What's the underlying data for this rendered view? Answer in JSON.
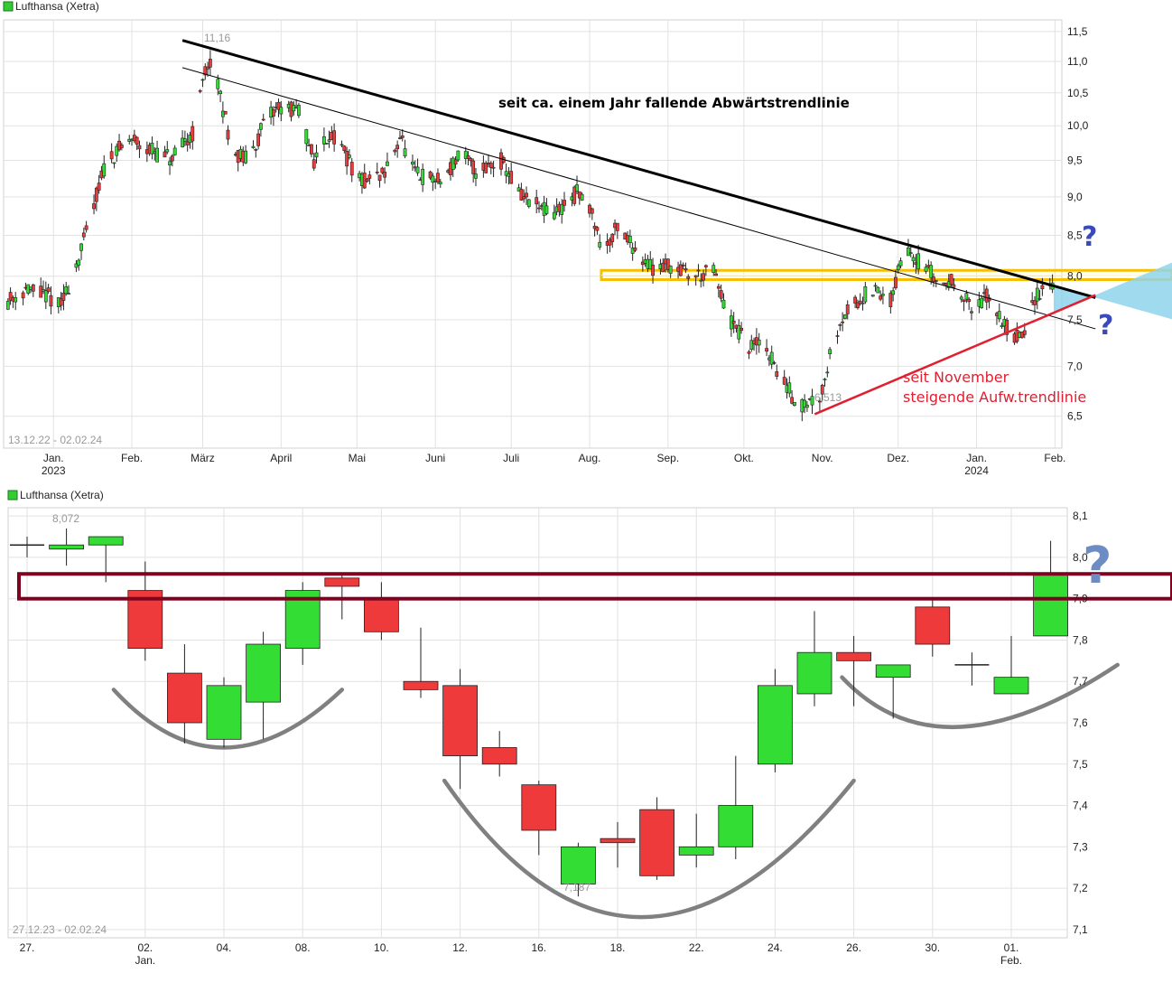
{
  "chart_data": [
    {
      "type": "candlestick",
      "title": "Lufthansa (Xetra)",
      "date_range": "13.12.22 - 02.02.24",
      "x_ticks": [
        {
          "label": "Jan.",
          "sub": "2023",
          "day": 19
        },
        {
          "label": "Feb.",
          "sub": "",
          "day": 50
        },
        {
          "label": "März",
          "sub": "",
          "day": 78
        },
        {
          "label": "April",
          "sub": "",
          "day": 109
        },
        {
          "label": "Mai",
          "sub": "",
          "day": 139
        },
        {
          "label": "Juni",
          "sub": "",
          "day": 170
        },
        {
          "label": "Juli",
          "sub": "",
          "day": 200
        },
        {
          "label": "Aug.",
          "sub": "",
          "day": 231
        },
        {
          "label": "Sep.",
          "sub": "",
          "day": 262
        },
        {
          "label": "Okt.",
          "sub": "",
          "day": 292
        },
        {
          "label": "Nov.",
          "sub": "",
          "day": 323
        },
        {
          "label": "Dez.",
          "sub": "",
          "day": 353
        },
        {
          "label": "Jan.",
          "sub": "2024",
          "day": 384
        },
        {
          "label": "Feb.",
          "sub": "",
          "day": 415
        }
      ],
      "y_ticks": [
        6.5,
        7.0,
        7.5,
        8.0,
        8.5,
        9.0,
        9.5,
        10.0,
        10.5,
        11.0,
        11.5
      ],
      "y_tick_labels": [
        "6,5",
        "7,0",
        "7,5",
        "8,0",
        "8,5",
        "9,0",
        "9,5",
        "10,0",
        "10,5",
        "11,0",
        "11,5"
      ],
      "ylim": [
        6.2,
        11.7
      ],
      "xlim": [
        0,
        417
      ],
      "log_scale": true,
      "grid": true,
      "price_path": [
        [
          0,
          7.7
        ],
        [
          8,
          7.85
        ],
        [
          18,
          7.75
        ],
        [
          22,
          7.65
        ],
        [
          30,
          8.3
        ],
        [
          40,
          9.5
        ],
        [
          50,
          9.8
        ],
        [
          60,
          9.6
        ],
        [
          66,
          9.5
        ],
        [
          74,
          9.9
        ],
        [
          80,
          11.0
        ],
        [
          84,
          10.6
        ],
        [
          90,
          9.6
        ],
        [
          96,
          9.5
        ],
        [
          102,
          10.0
        ],
        [
          108,
          10.3
        ],
        [
          116,
          10.2
        ],
        [
          122,
          9.5
        ],
        [
          128,
          9.9
        ],
        [
          134,
          9.6
        ],
        [
          140,
          9.2
        ],
        [
          150,
          9.3
        ],
        [
          156,
          9.85
        ],
        [
          162,
          9.3
        ],
        [
          172,
          9.2
        ],
        [
          180,
          9.6
        ],
        [
          186,
          9.35
        ],
        [
          196,
          9.5
        ],
        [
          204,
          9.0
        ],
        [
          216,
          8.75
        ],
        [
          226,
          9.05
        ],
        [
          232,
          8.8
        ],
        [
          236,
          8.3
        ],
        [
          242,
          8.6
        ],
        [
          250,
          8.3
        ],
        [
          256,
          8.1
        ],
        [
          262,
          8.15
        ],
        [
          272,
          8.0
        ],
        [
          280,
          8.05
        ],
        [
          286,
          7.5
        ],
        [
          294,
          7.2
        ],
        [
          300,
          7.25
        ],
        [
          306,
          6.9
        ],
        [
          314,
          6.6
        ],
        [
          322,
          6.7
        ],
        [
          330,
          7.5
        ],
        [
          342,
          7.85
        ],
        [
          350,
          7.7
        ],
        [
          356,
          8.4
        ],
        [
          362,
          8.15
        ],
        [
          370,
          7.9
        ],
        [
          376,
          7.95
        ],
        [
          382,
          7.6
        ],
        [
          388,
          7.75
        ],
        [
          392,
          7.6
        ],
        [
          398,
          7.3
        ],
        [
          403,
          7.35
        ],
        [
          408,
          7.8
        ],
        [
          415,
          7.95
        ]
      ],
      "annotations": [
        {
          "kind": "price_label",
          "text": "11,16",
          "day": 80,
          "value": 11.16
        },
        {
          "kind": "price_label",
          "text": "6,513",
          "day": 322,
          "value": 6.513
        },
        {
          "kind": "text",
          "text": "seit ca. einem Jahr fallende Abwärtstrendlinie",
          "color": "#000000"
        },
        {
          "kind": "text",
          "text": "seit November",
          "color": "#e02030"
        },
        {
          "kind": "text",
          "text": "steigende Aufw.trendlinie",
          "color": "#e02030"
        },
        {
          "kind": "text",
          "text": "?",
          "color": "#3a4ab8"
        },
        {
          "kind": "text",
          "text": "?",
          "color": "#3a4ab8"
        }
      ],
      "trendlines": [
        {
          "name": "bold downtrend",
          "points": [
            [
              70,
              11.35
            ],
            [
              431,
              7.75
            ]
          ],
          "color": "#000000"
        },
        {
          "name": "thin downtrend",
          "points": [
            [
              70,
              10.9
            ],
            [
              431,
              7.4
            ]
          ],
          "color": "#000000"
        },
        {
          "name": "uptrend",
          "points": [
            [
              320,
              6.52
            ],
            [
              431,
              7.78
            ]
          ],
          "color": "#e02030"
        }
      ],
      "zone": {
        "from": 7.96,
        "to": 8.07,
        "color": "#f5c000"
      }
    },
    {
      "type": "candlestick",
      "title": "Lufthansa (Xetra)",
      "date_range": "27.12.23 - 02.02.24",
      "x_ticks": [
        {
          "label": "27.",
          "sub": "",
          "i": 0
        },
        {
          "label": "02.",
          "sub": "Jan.",
          "i": 3
        },
        {
          "label": "04.",
          "sub": "",
          "i": 5
        },
        {
          "label": "08.",
          "sub": "",
          "i": 7
        },
        {
          "label": "10.",
          "sub": "",
          "i": 9
        },
        {
          "label": "12.",
          "sub": "",
          "i": 11
        },
        {
          "label": "16.",
          "sub": "",
          "i": 13
        },
        {
          "label": "18.",
          "sub": "",
          "i": 15
        },
        {
          "label": "22.",
          "sub": "",
          "i": 17
        },
        {
          "label": "24.",
          "sub": "",
          "i": 19
        },
        {
          "label": "26.",
          "sub": "",
          "i": 21
        },
        {
          "label": "30.",
          "sub": "",
          "i": 23
        },
        {
          "label": "01.",
          "sub": "Feb.",
          "i": 25
        }
      ],
      "y_ticks": [
        7.1,
        7.2,
        7.3,
        7.4,
        7.5,
        7.6,
        7.7,
        7.8,
        7.9,
        8.0,
        8.1
      ],
      "y_tick_labels": [
        "7,1",
        "7,2",
        "7,3",
        "7,4",
        "7,5",
        "7,6",
        "7,7",
        "7,8",
        "7,9",
        "8,0",
        "8,1"
      ],
      "ylim": [
        7.08,
        8.12
      ],
      "grid": true,
      "candles": [
        {
          "o": 8.03,
          "h": 8.05,
          "l": 8.0,
          "c": 8.03
        },
        {
          "o": 8.02,
          "h": 8.07,
          "l": 7.98,
          "c": 8.03
        },
        {
          "o": 8.03,
          "h": 8.05,
          "l": 7.94,
          "c": 8.05
        },
        {
          "o": 7.92,
          "h": 7.99,
          "l": 7.75,
          "c": 7.78
        },
        {
          "o": 7.72,
          "h": 7.79,
          "l": 7.55,
          "c": 7.6
        },
        {
          "o": 7.56,
          "h": 7.71,
          "l": 7.54,
          "c": 7.69
        },
        {
          "o": 7.65,
          "h": 7.82,
          "l": 7.56,
          "c": 7.79
        },
        {
          "o": 7.78,
          "h": 7.94,
          "l": 7.74,
          "c": 7.92
        },
        {
          "o": 7.95,
          "h": 7.96,
          "l": 7.85,
          "c": 7.93
        },
        {
          "o": 7.9,
          "h": 7.94,
          "l": 7.8,
          "c": 7.82
        },
        {
          "o": 7.7,
          "h": 7.83,
          "l": 7.66,
          "c": 7.68
        },
        {
          "o": 7.69,
          "h": 7.73,
          "l": 7.44,
          "c": 7.52
        },
        {
          "o": 7.54,
          "h": 7.58,
          "l": 7.47,
          "c": 7.5
        },
        {
          "o": 7.45,
          "h": 7.46,
          "l": 7.28,
          "c": 7.34
        },
        {
          "o": 7.21,
          "h": 7.31,
          "l": 7.18,
          "c": 7.3
        },
        {
          "o": 7.32,
          "h": 7.36,
          "l": 7.25,
          "c": 7.31
        },
        {
          "o": 7.39,
          "h": 7.42,
          "l": 7.22,
          "c": 7.23
        },
        {
          "o": 7.28,
          "h": 7.38,
          "l": 7.25,
          "c": 7.3
        },
        {
          "o": 7.3,
          "h": 7.52,
          "l": 7.27,
          "c": 7.4
        },
        {
          "o": 7.5,
          "h": 7.73,
          "l": 7.48,
          "c": 7.69
        },
        {
          "o": 7.67,
          "h": 7.87,
          "l": 7.64,
          "c": 7.77
        },
        {
          "o": 7.77,
          "h": 7.81,
          "l": 7.64,
          "c": 7.75
        },
        {
          "o": 7.71,
          "h": 7.74,
          "l": 7.61,
          "c": 7.74
        },
        {
          "o": 7.88,
          "h": 7.9,
          "l": 7.76,
          "c": 7.79
        },
        {
          "o": 7.74,
          "h": 7.77,
          "l": 7.69,
          "c": 7.74
        },
        {
          "o": 7.67,
          "h": 7.81,
          "l": 7.67,
          "c": 7.71
        },
        {
          "o": 7.81,
          "h": 8.04,
          "l": 7.81,
          "c": 7.96
        }
      ],
      "annotations": [
        {
          "kind": "price_label",
          "text": "8,072",
          "i": 1,
          "value": 8.072
        },
        {
          "kind": "price_label",
          "text": "7,187",
          "i": 14,
          "value": 7.187
        },
        {
          "kind": "text",
          "text": "?",
          "color": "#6d8cc4"
        }
      ],
      "zone": {
        "from": 7.9,
        "to": 7.96,
        "color": "#800020"
      },
      "arcs": [
        {
          "name": "left bowl",
          "from": [
            2.2,
            7.68
          ],
          "bottom": [
            5.0,
            7.54
          ],
          "to": [
            8.0,
            7.68
          ]
        },
        {
          "name": "middle bowl",
          "from": [
            10.6,
            7.46
          ],
          "bottom": [
            15.6,
            7.13
          ],
          "to": [
            21.0,
            7.46
          ]
        },
        {
          "name": "right bowl",
          "from": [
            20.7,
            7.71
          ],
          "bottom": [
            23.7,
            7.59
          ],
          "to": [
            27.7,
            7.74
          ]
        }
      ]
    }
  ]
}
